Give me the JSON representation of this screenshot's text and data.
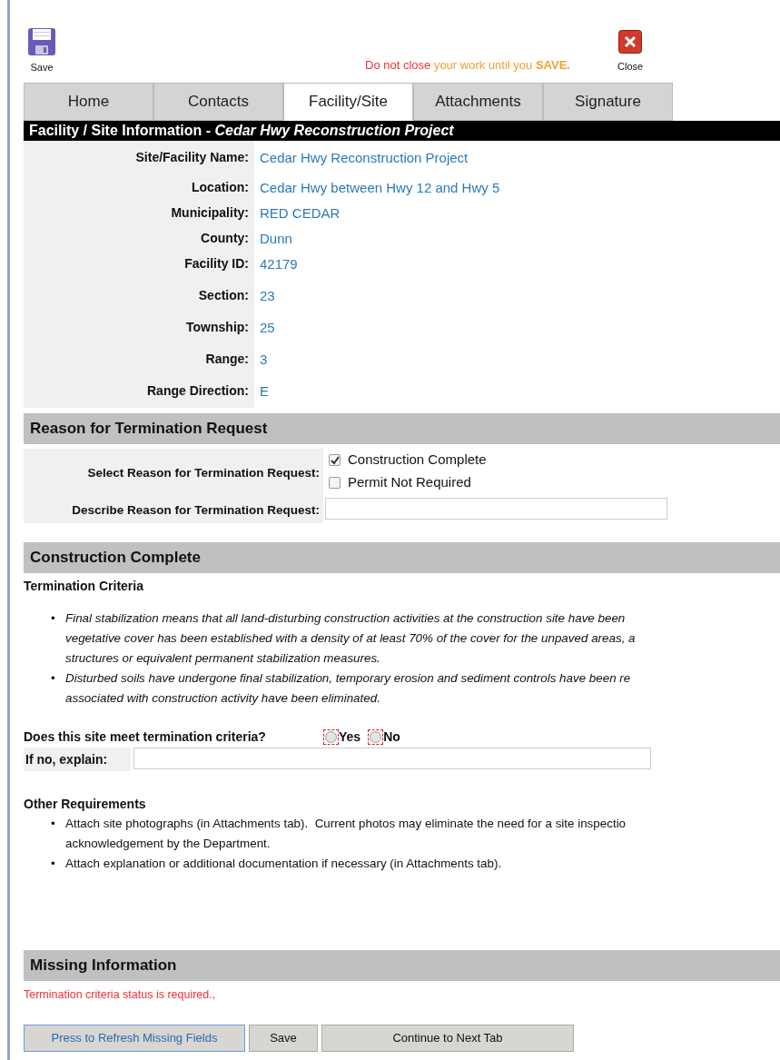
{
  "toolbar": {
    "save_label": "Save",
    "close_label": "Close",
    "warning_lead": "Do not close",
    "warning_rest": "your work until you **SAVE.**"
  },
  "tabs": [
    {
      "label": "Home",
      "selected": false
    },
    {
      "label": "Contacts",
      "selected": false
    },
    {
      "label": "Facility/Site",
      "selected": true
    },
    {
      "label": "Attachments",
      "selected": false
    },
    {
      "label": "Signature",
      "selected": false
    }
  ],
  "facility": {
    "title": "Facility / Site Information -",
    "project": "Cedar Hwy Reconstruction Project",
    "fields": [
      {
        "label": "Site/Facility Name:",
        "value": "Cedar Hwy Reconstruction Project"
      },
      {
        "label": "Location:",
        "value": "Cedar Hwy between Hwy 12 and Hwy 5"
      },
      {
        "label": "Municipality:",
        "value": "RED CEDAR"
      },
      {
        "label": "County:",
        "value": "Dunn"
      },
      {
        "label": "Facility ID:",
        "value": "42179"
      },
      {
        "label": "Section:",
        "value": "23"
      },
      {
        "label": "Township:",
        "value": "25"
      },
      {
        "label": "Range:",
        "value": "3"
      },
      {
        "label": "Range Direction:",
        "value": "E"
      }
    ]
  },
  "reason": {
    "heading": "Reason for Termination Request",
    "select_label": "Select Reason for Termination Request:",
    "options": [
      {
        "label": "Construction Complete",
        "checked": true
      },
      {
        "label": "Permit Not Required",
        "checked": false
      }
    ],
    "describe_label": "Describe Reason for Termination Request:"
  },
  "construction": {
    "heading": "Construction Complete",
    "criteria_heading": "Termination Criteria",
    "criteria": [
      {
        "marker": "•",
        "lines": [
          "Final stabilization means that all land-disturbing construction activities at the construction site have been",
          "vegetative cover has been established with a density of at least 70% of the cover for the unpaved areas, a",
          "structures or equivalent permanent stabilization measures."
        ]
      },
      {
        "marker": "•",
        "lines": [
          "Disturbed soils have undergone final stabilization, temporary erosion and sediment controls have been re",
          "associated with construction activity have been eliminated."
        ]
      }
    ],
    "question": "Does this site meet termination criteria?",
    "answers": [
      {
        "label": "Yes",
        "selected": false
      },
      {
        "label": "No",
        "selected": false
      }
    ],
    "explain_label": "If no, explain:",
    "other_heading": "Other Requirements",
    "other": [
      {
        "marker": "•",
        "lines": [
          "Attach site photographs (in Attachments tab).  Current photos may eliminate the need for a site inspectio",
          "acknowledgement by the Department."
        ]
      },
      {
        "marker": "•",
        "lines": [
          "Attach explanation or additional documentation if necessary (in Attachments tab)."
        ]
      }
    ]
  },
  "missing": {
    "heading": "Missing Information",
    "messages": [
      "Termination criteria status is required.,"
    ]
  },
  "buttons": [
    {
      "label": "Press to Refresh Missing Fields",
      "kind": "focused"
    },
    {
      "label": "Save",
      "kind": "plain"
    },
    {
      "label": "Continue to Next Tab",
      "kind": "plain"
    }
  ]
}
